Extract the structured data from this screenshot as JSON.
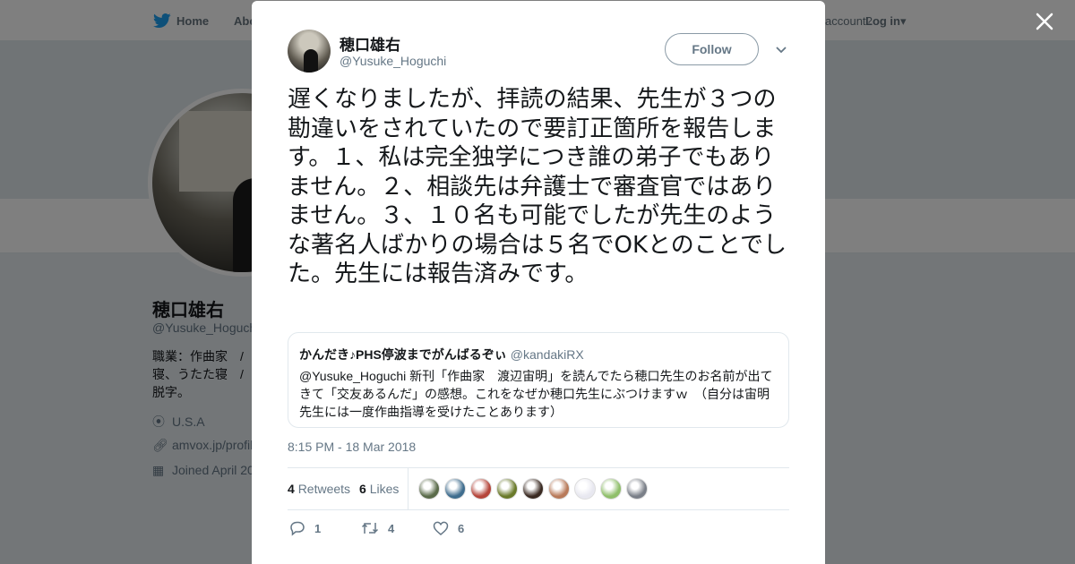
{
  "topbar": {
    "home_label": "Home",
    "about_label": "Abo",
    "account_text": "account?",
    "login_label": "Log in"
  },
  "profile": {
    "name": "穂口雄右",
    "handle": "@Yusuke_Hoguchi",
    "bio_lines": [
      "職業：作曲家　/",
      "寝、うたた寝　/",
      "脱字。"
    ],
    "location": "U.S.A",
    "website": "amvox.jp/profil",
    "joined": "Joined April 20"
  },
  "tweet": {
    "author_name": "穂口雄右",
    "author_handle": "@Yusuke_Hoguchi",
    "follow_label": "Follow",
    "text": "遅くなりましたが、拝読の結果、先生が３つの勘違いをされていたので要訂正箇所を報告します。１、私は完全独学につき誰の弟子でもありません。２、相談先は弁護士で審査官ではありません。３、１０名も可能でしたが先生のような著名人ばかりの場合は５名でOKとのことでした。先生には報告済みです。",
    "timestamp": "8:15 PM - 18 Mar 2018",
    "retweets_count": "4",
    "retweets_label": "Retweets",
    "likes_count": "6",
    "likes_label": "Likes",
    "reply_count": "1",
    "retweet_action_count": "4",
    "like_action_count": "6"
  },
  "quote": {
    "name": "かんだき♪PHS停波までがんばるぞぃ",
    "handle": "@kandakiRX",
    "text": "@Yusuke_Hoguchi 新刊「作曲家　渡辺宙明」を読んでたら穂口先生のお名前が出てきて「交友あるんだ」の感想。これをなぜか穂口先生にぶつけますｗ　（自分は宙明先生には一度作曲指導を受けたことあります）"
  },
  "likers": [
    "#5a6b4a",
    "#3f6d8e",
    "#b5453a",
    "#6a7a2a",
    "#3a2a22",
    "#b87a5a",
    "#e8e8f0",
    "#8fbf6a",
    "#7a7f88"
  ],
  "colors": {
    "twitter_blue": "#1da1f2",
    "muted": "#657786"
  }
}
